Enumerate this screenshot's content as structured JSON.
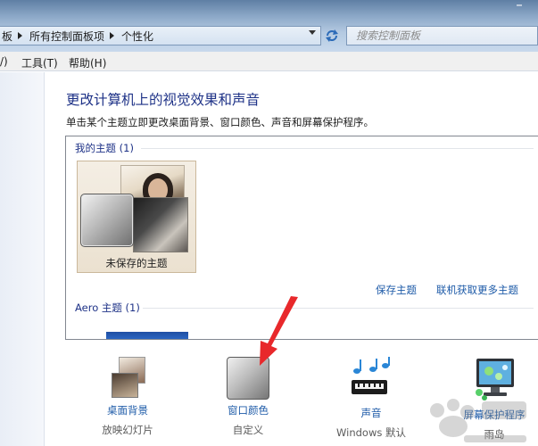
{
  "window": {
    "control_glyph": "–"
  },
  "breadcrumb": [
    {
      "label": "板"
    },
    {
      "label": "所有控制面板项"
    },
    {
      "label": "个性化"
    }
  ],
  "search": {
    "placeholder": "搜索控制面板"
  },
  "menu": [
    {
      "label": "/)"
    },
    {
      "label": "工具(T)"
    },
    {
      "label": "帮助(H)"
    }
  ],
  "main": {
    "title": "更改计算机上的视觉效果和声音",
    "description": "单击某个主题立即更改桌面背景、窗口颜色、声音和屏幕保护程序。"
  },
  "themes": {
    "my_section": "我的主题 (1)",
    "unsaved_label": "未保存的主题",
    "save_link": "保存主题",
    "online_link": "联机获取更多主题",
    "aero_section": "Aero 主题 (1)"
  },
  "bottom": [
    {
      "title": "桌面背景",
      "subtitle": "放映幻灯片",
      "icon": "desktop-background-icon"
    },
    {
      "title": "窗口颜色",
      "subtitle": "自定义",
      "icon": "window-color-icon"
    },
    {
      "title": "声音",
      "subtitle": "Windows 默认",
      "icon": "sound-icon"
    },
    {
      "title": "屏幕保护程序",
      "subtitle": "雨岛",
      "icon": "screensaver-icon"
    }
  ],
  "colors": {
    "link": "#1e5ba8",
    "heading": "#1e3287",
    "annotation_arrow": "#e8282b"
  }
}
